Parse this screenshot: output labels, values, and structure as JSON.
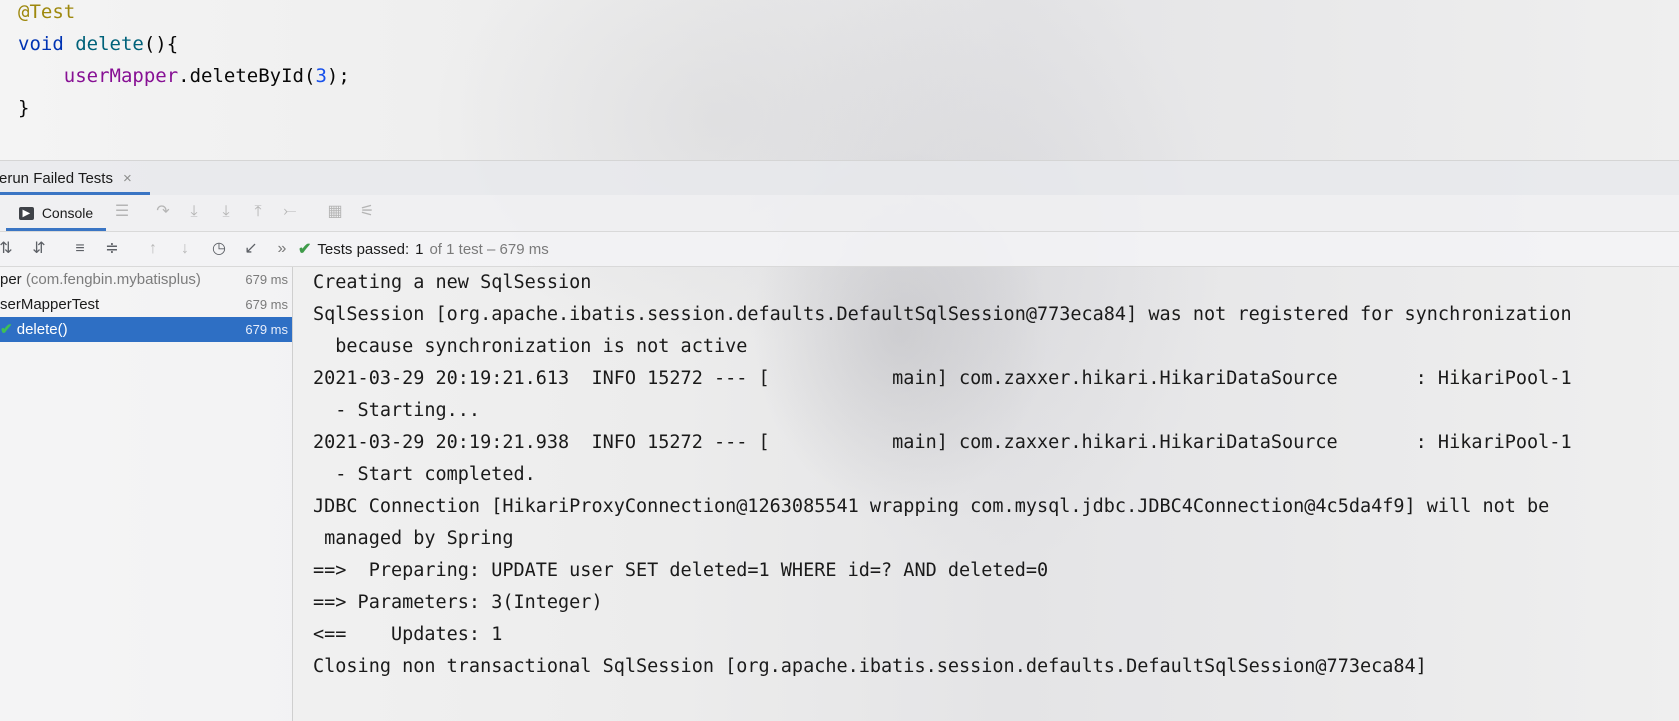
{
  "editor": {
    "annotation": "@Test",
    "kw_void": "void",
    "method_name": "delete",
    "method_parens": "(){",
    "indent": "    ",
    "field": "userMapper",
    "call": ".deleteById(",
    "arg": "3",
    "call_end": ");",
    "close_brace": "}"
  },
  "run_tab": {
    "label": "erun Failed Tests",
    "close": "×"
  },
  "console_tab": {
    "label": "Console",
    "icon": "▶"
  },
  "console_toolbar_icons": [
    "menu-icon",
    "rerun-icon",
    "scroll-down-icon",
    "import-icon",
    "export-icon",
    "soft-wrap-icon",
    "print-icon",
    "settings-icon"
  ],
  "results_toolbar_icons": [
    "sort-alpha-icon",
    "sort-duration-icon",
    "expand-all-icon",
    "collapse-all-icon",
    "prev-failed-icon",
    "next-failed-icon",
    "history-icon",
    "export-test-results-icon"
  ],
  "status": {
    "expand": "»",
    "check": "✔",
    "label": "Tests passed:",
    "count": "1",
    "detail": "of 1 test – 679 ms"
  },
  "tree": [
    {
      "name": "per",
      "pkg": "(com.fengbin.mybatisplus)",
      "time": "679 ms",
      "selected": false
    },
    {
      "name": "serMapperTest",
      "pkg": "",
      "time": "679 ms",
      "selected": false
    },
    {
      "name": "delete()",
      "pkg": "",
      "time": "679 ms",
      "selected": true
    }
  ],
  "console": [
    "Creating a new SqlSession",
    "SqlSession [org.apache.ibatis.session.defaults.DefaultSqlSession@773eca84] was not registered for synchronization",
    "  because synchronization is not active",
    "2021-03-29 20:19:21.613  INFO 15272 --- [           main] com.zaxxer.hikari.HikariDataSource       : HikariPool-1",
    "  - Starting...",
    "2021-03-29 20:19:21.938  INFO 15272 --- [           main] com.zaxxer.hikari.HikariDataSource       : HikariPool-1",
    "  - Start completed.",
    "JDBC Connection [HikariProxyConnection@1263085541 wrapping com.mysql.jdbc.JDBC4Connection@4c5da4f9] will not be",
    " managed by Spring",
    "==>  Preparing: UPDATE user SET deleted=1 WHERE id=? AND deleted=0",
    "==> Parameters: 3(Integer)",
    "<==    Updates: 1",
    "Closing non transactional SqlSession [org.apache.ibatis.session.defaults.DefaultSqlSession@773eca84]"
  ]
}
